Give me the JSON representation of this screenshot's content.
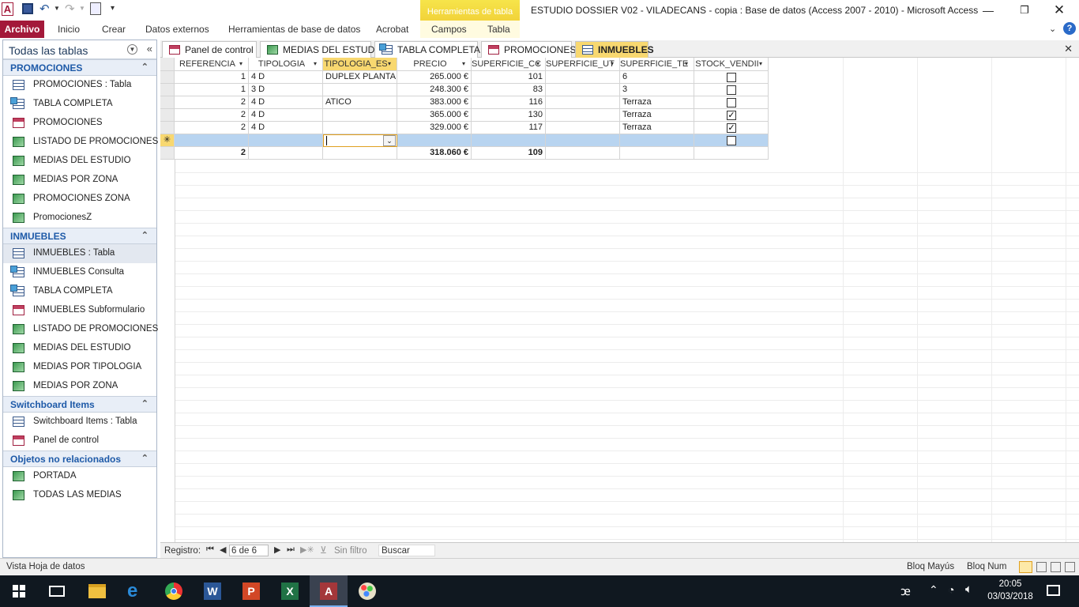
{
  "window": {
    "title": "ESTUDIO DOSSIER V02 - VILADECANS - copia : Base de datos (Access 2007 - 2010)  -  Microsoft Access",
    "context_tab": "Herramientas de tabla"
  },
  "ribbon": {
    "file": "Archivo",
    "tabs": [
      "Inicio",
      "Crear",
      "Datos externos",
      "Herramientas de base de datos",
      "Acrobat",
      "Campos",
      "Tabla"
    ]
  },
  "nav": {
    "header": "Todas las tablas",
    "groups": [
      {
        "title": "PROMOCIONES",
        "items": [
          {
            "label": "PROMOCIONES : Tabla",
            "icon": "table-icon"
          },
          {
            "label": "TABLA COMPLETA",
            "icon": "query-icon"
          },
          {
            "label": "PROMOCIONES",
            "icon": "form-icon"
          },
          {
            "label": "LISTADO DE PROMOCIONES",
            "icon": "report-icon"
          },
          {
            "label": "MEDIAS DEL ESTUDIO",
            "icon": "report-icon"
          },
          {
            "label": "MEDIAS POR ZONA",
            "icon": "report-icon"
          },
          {
            "label": "PROMOCIONES ZONA",
            "icon": "report-icon"
          },
          {
            "label": "PromocionesZ",
            "icon": "report-icon"
          }
        ]
      },
      {
        "title": "INMUEBLES",
        "items": [
          {
            "label": "INMUEBLES : Tabla",
            "icon": "table-icon"
          },
          {
            "label": "INMUEBLES Consulta",
            "icon": "query-icon"
          },
          {
            "label": "TABLA COMPLETA",
            "icon": "query-icon"
          },
          {
            "label": "INMUEBLES Subformulario",
            "icon": "form-icon"
          },
          {
            "label": "LISTADO DE PROMOCIONES",
            "icon": "report-icon"
          },
          {
            "label": "MEDIAS DEL ESTUDIO",
            "icon": "report-icon"
          },
          {
            "label": "MEDIAS POR TIPOLOGIA",
            "icon": "report-icon"
          },
          {
            "label": "MEDIAS POR ZONA",
            "icon": "report-icon"
          }
        ]
      },
      {
        "title": "Switchboard Items",
        "items": [
          {
            "label": "Switchboard Items : Tabla",
            "icon": "table-icon"
          },
          {
            "label": "Panel de control",
            "icon": "form-icon"
          }
        ]
      },
      {
        "title": "Objetos no relacionados",
        "items": [
          {
            "label": "PORTADA",
            "icon": "report-icon"
          },
          {
            "label": "TODAS LAS MEDIAS",
            "icon": "report-icon"
          }
        ]
      }
    ]
  },
  "doc_tabs": [
    {
      "label": "Panel de control",
      "icon": "form-icon"
    },
    {
      "label": "MEDIAS DEL ESTUDIO",
      "icon": "report-icon"
    },
    {
      "label": "TABLA COMPLETA",
      "icon": "query-icon"
    },
    {
      "label": "PROMOCIONES",
      "icon": "form-icon"
    },
    {
      "label": "INMUEBLES",
      "icon": "table-icon"
    }
  ],
  "table": {
    "columns": [
      "REFERENCIA",
      "TIPOLOGIA",
      "TIPOLOGIA_ES",
      "PRECIO",
      "SUPERFICIE_CC",
      "SUPERFICIE_UT",
      "SUPERFICIE_TE",
      "STOCK_VENDII"
    ],
    "rows": [
      [
        "1",
        "4 D",
        "DUPLEX PLANTA E",
        "265.000 €",
        "101",
        "",
        "6",
        false
      ],
      [
        "1",
        "3 D",
        "",
        "248.300 €",
        "83",
        "",
        "3",
        false
      ],
      [
        "2",
        "4 D",
        "ATICO",
        "383.000 €",
        "116",
        "",
        "Terraza",
        false
      ],
      [
        "2",
        "4 D",
        "",
        "365.000 €",
        "130",
        "",
        "Terraza",
        true
      ],
      [
        "2",
        "4 D",
        "",
        "329.000 €",
        "117",
        "",
        "Terraza",
        true
      ]
    ],
    "totals": [
      "2",
      "",
      "",
      "318.060 €",
      "109",
      "",
      "",
      ""
    ],
    "new_row_marker": "✳"
  },
  "recnav": {
    "label": "Registro:",
    "position": "6 de 6",
    "filter": "Sin filtro",
    "search": "Buscar"
  },
  "status": {
    "left": "Vista Hoja de datos",
    "caps": "Bloq Mayús",
    "num": "Bloq Num"
  },
  "clock": {
    "time": "20:05",
    "date": "03/03/2018"
  }
}
